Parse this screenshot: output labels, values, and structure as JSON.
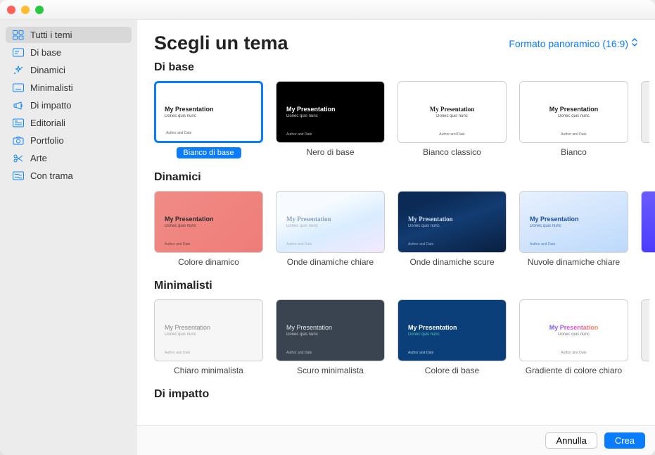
{
  "header": {
    "title": "Scegli un tema",
    "format_label": "Formato panoramico (16:9)"
  },
  "sidebar": {
    "items": [
      {
        "label": "Tutti i temi"
      },
      {
        "label": "Di base"
      },
      {
        "label": "Dinamici"
      },
      {
        "label": "Minimalisti"
      },
      {
        "label": "Di impatto"
      },
      {
        "label": "Editoriali"
      },
      {
        "label": "Portfolio"
      },
      {
        "label": "Arte"
      },
      {
        "label": "Con trama"
      }
    ]
  },
  "thumb_text": {
    "title": "My Presentation",
    "subtitle": "Donec quis nunc",
    "author": "Author and Date"
  },
  "sections": [
    {
      "title": "Di base",
      "themes": [
        {
          "label": "Bianco di base",
          "selected": true
        },
        {
          "label": "Nero di base"
        },
        {
          "label": "Bianco classico"
        },
        {
          "label": "Bianco"
        }
      ]
    },
    {
      "title": "Dinamici",
      "themes": [
        {
          "label": "Colore dinamico"
        },
        {
          "label": "Onde dinamiche chiare"
        },
        {
          "label": "Onde dinamiche scure"
        },
        {
          "label": "Nuvole dinamiche chiare"
        }
      ]
    },
    {
      "title": "Minimalisti",
      "themes": [
        {
          "label": "Chiaro minimalista"
        },
        {
          "label": "Scuro minimalista"
        },
        {
          "label": "Colore di base"
        },
        {
          "label": "Gradiente di colore chiaro"
        }
      ]
    },
    {
      "title": "Di impatto",
      "themes": []
    }
  ],
  "footer": {
    "cancel": "Annulla",
    "create": "Crea"
  }
}
